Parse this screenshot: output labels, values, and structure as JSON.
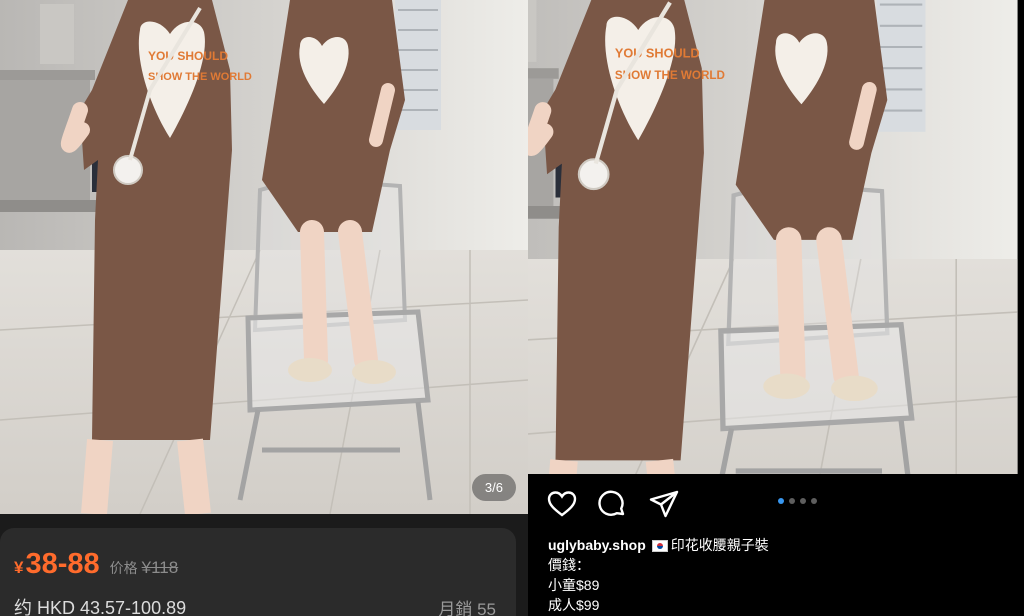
{
  "left": {
    "image_counter": "3/6",
    "price": {
      "currency_symbol": "¥",
      "range": "38-88",
      "original_label": "价格",
      "original_price": "¥118",
      "hkd_approx": "约 HKD 43.57-100.89",
      "monthly_sales": "月銷 55"
    }
  },
  "right": {
    "carousel": {
      "dot_count": 4,
      "active_index": 0
    },
    "caption": {
      "username": "uglybaby.shop",
      "title": "印花收腰親子裝",
      "lines": [
        "價錢：",
        "小童$89",
        "成人$99"
      ]
    },
    "icons": [
      "heart-icon",
      "comment-icon",
      "share-icon"
    ]
  },
  "colors": {
    "price_orange": "#ff6b2c",
    "dress_brown": "#7a5746",
    "ig_blue": "#3897f0"
  }
}
